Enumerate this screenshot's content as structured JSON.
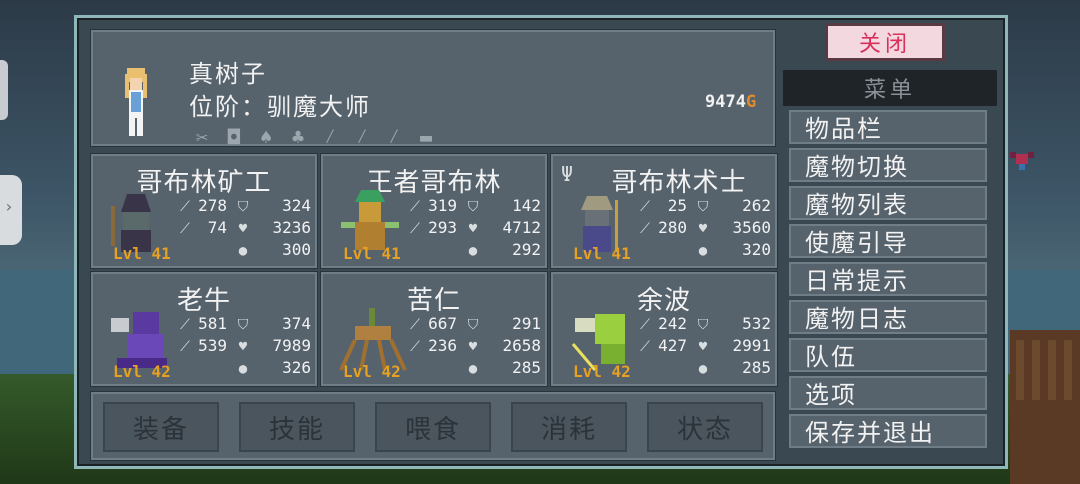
{
  "character": {
    "name": "真树子",
    "rank": "位阶：驯魔大师",
    "gold_amount": "9474",
    "gold_unit": "G"
  },
  "equipment_icons": [
    "bone-icon",
    "bag-icon",
    "mushroom-icon",
    "potion-icon",
    "feather-icon",
    "leaf-icon",
    "feather-icon",
    "scroll-icon"
  ],
  "monsters": [
    {
      "name": "哥布林矿工",
      "level": "Lvl 41",
      "atk": "278",
      "def": "324",
      "mag": "74",
      "hp": "3236",
      "weight": "300"
    },
    {
      "name": "王者哥布林",
      "level": "Lvl 41",
      "atk": "319",
      "def": "142",
      "mag": "293",
      "hp": "4712",
      "weight": "292"
    },
    {
      "name": "哥布林术士",
      "level": "Lvl 41",
      "atk": "25",
      "def": "262",
      "mag": "280",
      "hp": "3560",
      "weight": "320"
    },
    {
      "name": "老牛",
      "level": "Lvl 42",
      "atk": "581",
      "def": "374",
      "mag": "539",
      "hp": "7989",
      "weight": "326"
    },
    {
      "name": "苦仁",
      "level": "Lvl 42",
      "atk": "667",
      "def": "291",
      "mag": "236",
      "hp": "2658",
      "weight": "285"
    },
    {
      "name": "余波",
      "level": "Lvl 42",
      "atk": "242",
      "def": "532",
      "mag": "427",
      "hp": "2991",
      "weight": "285"
    }
  ],
  "tabs": [
    "装备",
    "技能",
    "喂食",
    "消耗",
    "状态"
  ],
  "close_label": "关闭",
  "menu": {
    "title": "菜单",
    "items": [
      "物品栏",
      "魔物切换",
      "魔物列表",
      "使魔引导",
      "日常提示",
      "魔物日志",
      "队伍",
      "选项",
      "保存并退出"
    ]
  },
  "colors": {
    "frame_border": "#8fb7b8",
    "panel": "#56636d",
    "level": "#e8a020",
    "close_text": "#d8305a",
    "gold_g": "#e08a2a"
  }
}
